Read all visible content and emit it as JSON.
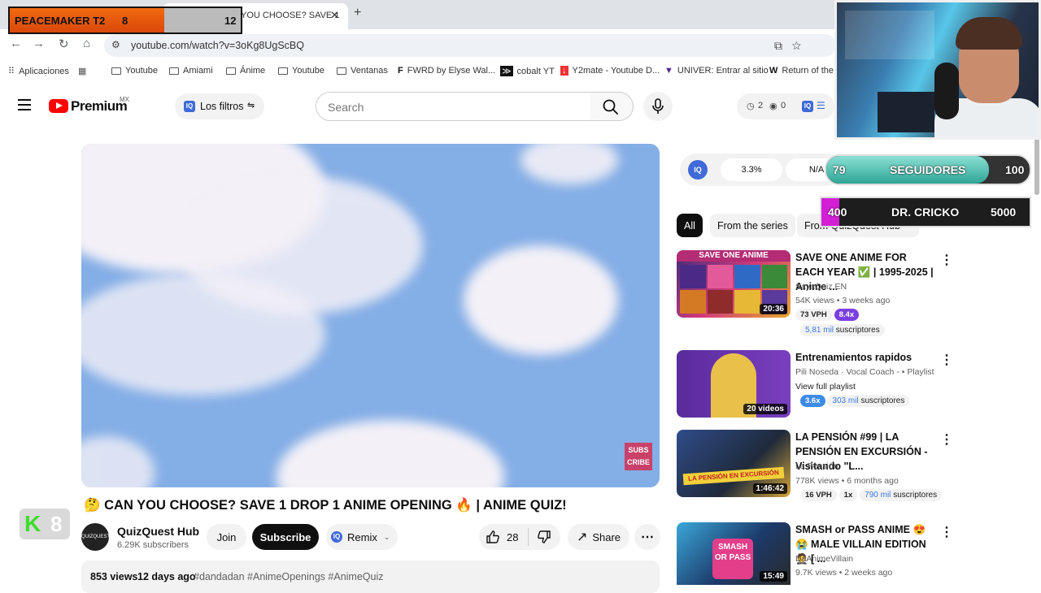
{
  "browser": {
    "tab_title": "YOU CHOOSE? SAVE 1",
    "url": "youtube.com/watch?v=3oKg8UgScBQ",
    "bookmarks": [
      "Aplicaciones",
      "Youtube",
      "Amiami",
      "Ánime",
      "Youtube",
      "Ventanas",
      "FWRD by Elyse Wal...",
      "cobalt YT",
      "Y2mate - Youtube D...",
      "UNIVER: Entrar al sitio",
      "Return of the"
    ]
  },
  "overlay": {
    "pm_name": "PEACEMAKER T2",
    "pm_current": "8",
    "pm_max": "12",
    "k_badge_number": "8",
    "seg_current": "79",
    "seg_label": "SEGUIDORES",
    "seg_goal": "100",
    "dr_current": "400",
    "dr_label": "DR. CRICKO",
    "dr_goal": "5000"
  },
  "header": {
    "brand": "Premium",
    "region": "MX",
    "filters_label": "Los filtros",
    "search_placeholder": "Search",
    "stat_a": "2",
    "stat_b": "0"
  },
  "video": {
    "title": "CAN YOU CHOOSE? SAVE 1 DROP 1 ANIME OPENING 🔥 | ANIME QUIZ!",
    "subs_badge_line1": "SUBS",
    "subs_badge_line2": "CRIBE",
    "channel": "QuizQuest Hub",
    "channel_subs": "6.29K subscribers",
    "avatar_text": "QUIZQUEST",
    "join": "Join",
    "subscribe": "Subscribe",
    "remix": "Remix",
    "likes": "28",
    "share": "Share",
    "views": "853 views",
    "date": "12 days ago",
    "hashtags": "#dandadan #AnimeOpenings #AnimeQuiz"
  },
  "sidebar": {
    "iq_percent": "3.3%",
    "iq_na": "N/A",
    "chips": [
      "All",
      "From the series",
      "From QuizQuest Hub"
    ],
    "recs": [
      {
        "thumb_label": "SAVE ONE ANIME",
        "duration": "20:36",
        "title": "SAVE ONE ANIME FOR EACH YEAR ✅ | 1995-2025 | Anime ...",
        "channel": "SayaQuiz EN",
        "meta": "54K views • 3 weeks ago",
        "vph": "73 VPH",
        "mult": "8.4x",
        "subs_num": "5,81 mil",
        "subs_word": "suscriptores"
      },
      {
        "thumb_label": "",
        "duration": "20 videos",
        "title": "Entrenamientos rapidos",
        "channel": "Pili Noseda · Vocal Coach - • Playlist",
        "meta": "View full playlist",
        "vph": "",
        "mult": "3.6x",
        "subs_num": "303 mil",
        "subs_word": "suscriptores"
      },
      {
        "thumb_label": "LA PENSIÓN EN EXCURSIÓN",
        "duration": "1:46:42",
        "title": "LA PENSIÓN #99 | LA PENSIÓN EN EXCURSIÓN - Visitando \"L...",
        "channel": "La Pensión",
        "meta": "778K views • 6 months ago",
        "vph": "16 VPH",
        "mult": "1x",
        "subs_num": "790 mil",
        "subs_word": "suscriptores"
      },
      {
        "thumb_label": "SMASH OR PASS",
        "duration": "15:49",
        "title": "SMASH or PASS ANIME 😍 😭 MALE VILLAIN EDITION 🤵 [ ...",
        "channel": "DaAnimeVillain",
        "meta": "9.7K views • 2 weeks ago",
        "vph": "",
        "mult": "",
        "subs_num": "",
        "subs_word": ""
      }
    ]
  },
  "colors": {
    "yt_red": "#ff0000",
    "iq_blue": "#3f6ad8",
    "pm_orange": "#f06a10",
    "seg_teal": "#2fa596",
    "dr_magenta": "#d21fd6"
  }
}
